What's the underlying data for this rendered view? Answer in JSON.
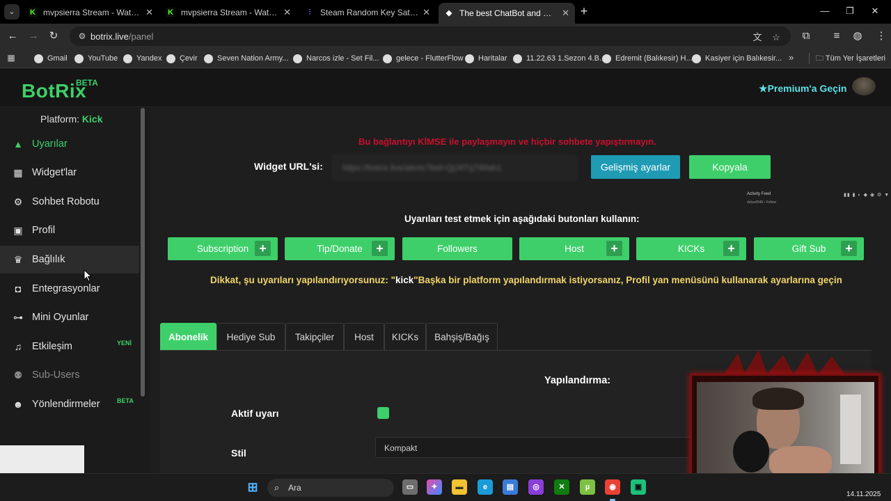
{
  "browser": {
    "tabs": [
      {
        "title": "mvpsierra Stream - Watch Live",
        "favicon": "K",
        "favicon_color": "#53fc18"
      },
      {
        "title": "mvpsierra Stream - Watch Live",
        "favicon": "K",
        "favicon_color": "#53fc18"
      },
      {
        "title": "Steam Random Key Satın Al - E",
        "favicon": "⫶",
        "favicon_color": "#6a6cff"
      },
      {
        "title": "The best ChatBot and Widgets",
        "favicon": "◆",
        "favicon_color": "#ffffff"
      }
    ],
    "url_host": "botrix.live",
    "url_path": "/panel",
    "bookmarks": [
      "Gmail",
      "YouTube",
      "Yandex",
      "Çevir",
      "Seven Nation Army...",
      "Narcos izle - Set Fil...",
      "gelece - FlutterFlow",
      "Haritalar",
      "11.22.63 1.Sezon 4.B...",
      "Edremit (Balıkesir) H...",
      "Kasiyer için Balıkesir..."
    ],
    "bookmarks_folder": "Tüm Yer İşaretleri"
  },
  "app": {
    "logo": "BotRix",
    "logo_badge": "BETA",
    "premium": "Premium'a Geçin",
    "platform_label": "Platform:",
    "platform_value": "Kick",
    "brand_color": "#3ecf6a"
  },
  "sidebar": {
    "items": [
      {
        "label": "Uyarılar",
        "icon": "warning-icon"
      },
      {
        "label": "Widget'lar",
        "icon": "grid-icon"
      },
      {
        "label": "Sohbet Robotu",
        "icon": "robot-icon"
      },
      {
        "label": "Profil",
        "icon": "id-card-icon"
      },
      {
        "label": "Bağlılık",
        "icon": "trophy-icon"
      },
      {
        "label": "Entegrasyonlar",
        "icon": "plug-icon"
      },
      {
        "label": "Mini Oyunlar",
        "icon": "gamepad-icon"
      },
      {
        "label": "Etkileşim",
        "icon": "music-icon",
        "badge": "YENİ"
      },
      {
        "label": "Sub-Users",
        "icon": "users-icon"
      },
      {
        "label": "Yönlendirmeler",
        "icon": "user-arrow-icon",
        "badge": "BETA"
      }
    ]
  },
  "main": {
    "warning": "Bu bağlantıyı KİMSE ile paylaşmayın ve hiçbir sohbete yapıştırmayın.",
    "widget_url_label": "Widget URL'si:",
    "widget_url_value": "https://botrix.live/alerts?bid=QjJ4Tq7Wlah1",
    "advanced_button": "Gelişmiş ayarlar",
    "copy_button": "Kopyala",
    "activity_feed_title": "Activity Feed",
    "activity_feed_line": "dolya4548 • Follow",
    "test_heading": "Uyarıları test etmek için aşağıdaki butonları kullanın:",
    "test_buttons": [
      "Subscription",
      "Tip/Donate",
      "Followers",
      "Host",
      "KICKs",
      "Gift Sub"
    ],
    "notice_prefix": "Dikkat, şu uyarıları yapılandırıyorsunuz: \"",
    "notice_keyword": "kick",
    "notice_suffix": "\"Başka bir platform yapılandırmak istiyorsanız, Profil yan menüsünü kullanarak ayarlarına geçin",
    "tabs": [
      "Abonelik",
      "Hediye Sub",
      "Takipçiler",
      "Host",
      "KICKs",
      "Bahşiş/Bağış"
    ],
    "config_title": "Yapılandırma:",
    "active_alert_label": "Aktif uyarı",
    "active_alert_checked": true,
    "style_label": "Stil",
    "style_value": "Kompakt"
  },
  "taskbar": {
    "search_placeholder": "Ara",
    "date": "14.11.2025"
  }
}
